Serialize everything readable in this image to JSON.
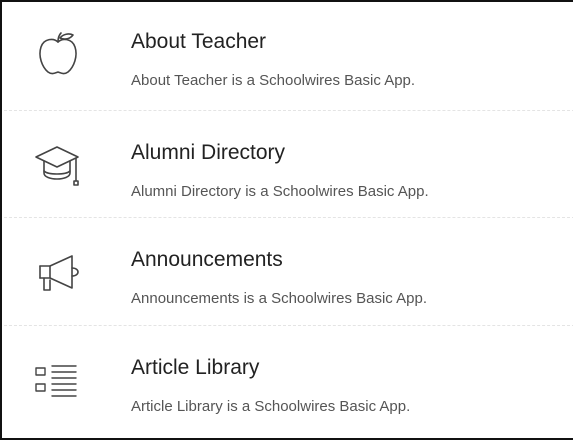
{
  "apps": [
    {
      "title": "About Teacher",
      "description": "About Teacher is a Schoolwires Basic App.",
      "icon": "apple-icon"
    },
    {
      "title": "Alumni Directory",
      "description": "Alumni Directory is a Schoolwires Basic App.",
      "icon": "graduation-cap-icon"
    },
    {
      "title": "Announcements",
      "description": "Announcements is a Schoolwires Basic App.",
      "icon": "megaphone-icon"
    },
    {
      "title": "Article Library",
      "description": "Article Library is a Schoolwires Basic App.",
      "icon": "list-icon"
    }
  ],
  "colors": {
    "border": "#111111",
    "title": "#222222",
    "description": "#555555",
    "icon_stroke": "#444444",
    "divider": "#e4e4e4"
  }
}
